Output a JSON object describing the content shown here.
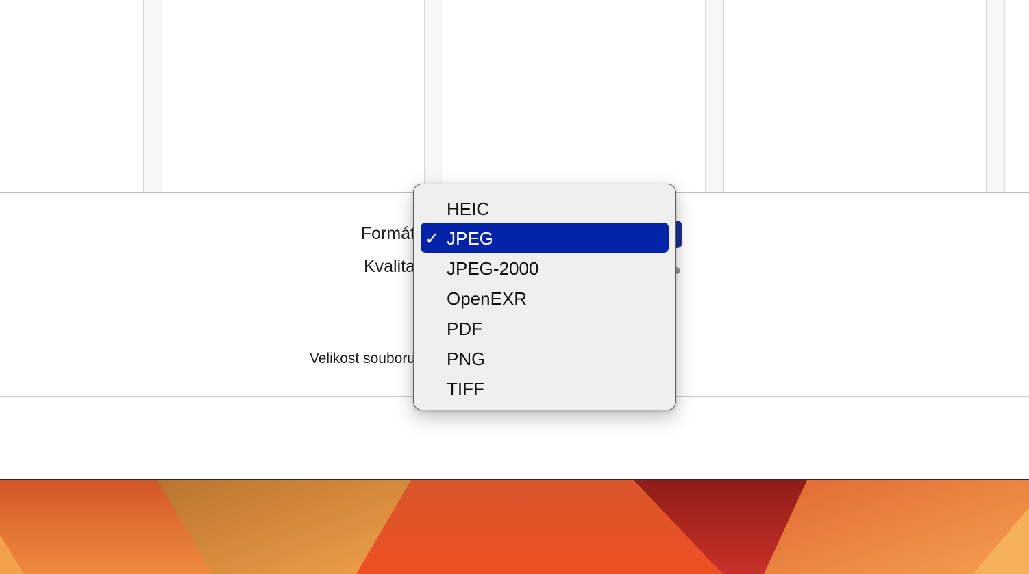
{
  "options": {
    "format_label": "Formát",
    "quality_label": "Kvalita",
    "file_size_label": "Velikost souboru"
  },
  "format_menu": {
    "selected": "JPEG",
    "items": [
      {
        "label": "HEIC",
        "checked": false
      },
      {
        "label": "JPEG",
        "checked": true
      },
      {
        "label": "JPEG-2000",
        "checked": false
      },
      {
        "label": "OpenEXR",
        "checked": false
      },
      {
        "label": "PDF",
        "checked": false
      },
      {
        "label": "PNG",
        "checked": false
      },
      {
        "label": "TIFF",
        "checked": false
      }
    ],
    "check_glyph": "✓",
    "highlight_color": "#0324a8"
  },
  "icons": {
    "checkmark": "checkmark-icon"
  }
}
